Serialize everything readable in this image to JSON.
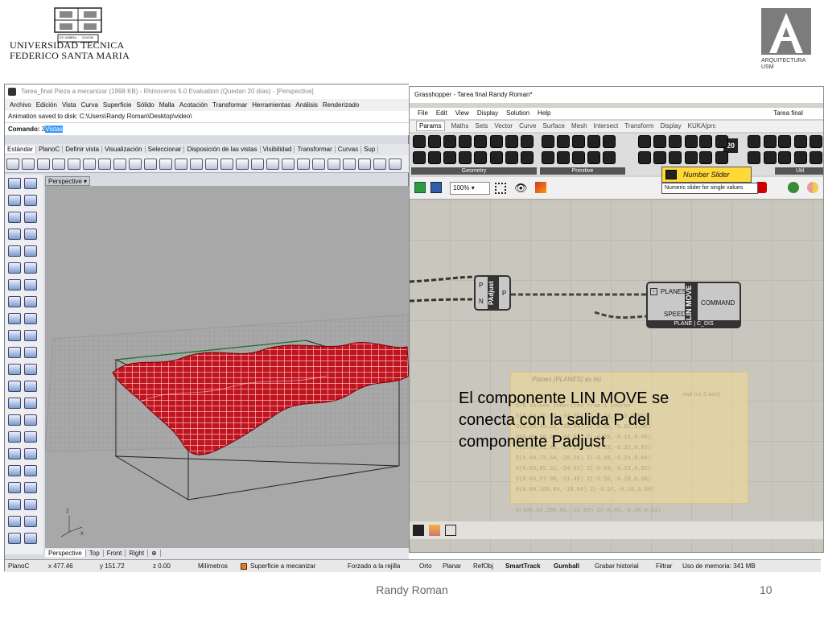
{
  "header": {
    "university_line1": "UNIVERSIDAD TECNICA",
    "university_line2": "FEDERICO SANTA MARIA",
    "crest_motto_left": "EX UMBRA",
    "crest_motto_right": "SOLEM",
    "arch_line1": "ARQUITECTURA",
    "arch_line2": "USM"
  },
  "rhino": {
    "title": "Tarea_final Pieza a mecanizar (1998 KB) - Rhinoceros 5.0 Evaluation (Quedan 20 días) - [Perspective]",
    "menu": [
      "Archivo",
      "Edición",
      "Vista",
      "Curva",
      "Superficie",
      "Sólido",
      "Malla",
      "Acotación",
      "Transformar",
      "Herramientas",
      "Análisis",
      "Renderizado"
    ],
    "command_history": "Animation saved to disk: C:\\Users\\Randy Roman\\Desktop\\video\\",
    "command_label": "Comando:",
    "command_prefix": "3",
    "command_value": "Vistas",
    "toolbar_tabs": [
      "Estándar",
      "PlanoC",
      "Definir vista",
      "Visualización",
      "Seleccionar",
      "Disposición de las vistas",
      "Visibilidad",
      "Transformar",
      "Curvas",
      "Sup"
    ],
    "viewport_label": "Perspective",
    "viewport_tabs": [
      "Perspective",
      "Top",
      "Front",
      "Right"
    ],
    "add_tab_glyph": "⊕",
    "axis_z": "z",
    "axis_x": "x",
    "status": {
      "cplane": "PlanoC",
      "x": "x 477.46",
      "y": "y 151.72",
      "z": "z 0.00",
      "units": "Milímetros",
      "layer": "Superficie a mecanizar",
      "snap": "Forzado a la rejilla",
      "ortho": "Orto",
      "planar": "Planar",
      "osnap": "RefObj",
      "smarttrack": "SmartTrack",
      "gumball": "Gumball",
      "history": "Grabar historial",
      "filter": "Filtrar",
      "memory": "Uso de memoria: 341 MB"
    }
  },
  "grasshopper": {
    "title": "Grasshopper - Tarea final Randy Roman*",
    "file_name": "Tarea final Randy",
    "menu": [
      "File",
      "Edit",
      "View",
      "Display",
      "Solution",
      "Help"
    ],
    "tabs": [
      "Params",
      "Maths",
      "Sets",
      "Vector",
      "Curve",
      "Surface",
      "Mesh",
      "Intersect",
      "Transform",
      "Display",
      "KUKA|prc"
    ],
    "groups": [
      "Geometry",
      "Primitive",
      "Util"
    ],
    "slider_badge": "20",
    "zoom": "100%",
    "tooltip_title": "Number Slider",
    "tooltip_desc": "Numeric slider for single values",
    "padjust": {
      "in_p": "P",
      "in_n": "N",
      "name": "PAdjust",
      "out": "P"
    },
    "linmove": {
      "in1": "PLANES",
      "in2": "SPEED",
      "name": "LIN MOVE",
      "out": "COMMAND",
      "footer": "PLANE | C_DIS"
    },
    "panel": {
      "header": "Planes (PLANES) as list",
      "aside": "mal (i.e Z-axis)",
      "lines": [
        "676 values inherited from 1 source",
        "O(0.00,26.92,-34.35) Z(-0.13,0.13,0.98)",
        "O(0.00,39.23,-28.94) Z(-0.09,-0.03,1.00)",
        "O(0.00,50.31,-34.93) Z(-0.20,-0.16,0.96)",
        "O(0.00,61.45,-27.29) Z(-0.23,-0.22,0.93)",
        "O(0.00,73.54,-26.20) Z(-0.49,-0.24,0.84)",
        "O(0.00,85.32,-24.63) Z(-0.54,-0.23,0.81)",
        "O(0.00,97.08,-21.49) Z(-0.56,-0.20,0.80)",
        "O(0.00,109.84,-18.84) Z(-0.57,-0.16,0.80)",
        "...",
        "O(300.00,300.00,-25.69) Z(-0.40,-0.40,0.83)"
      ]
    }
  },
  "callout": "El componente LIN MOVE se conecta con la salida P del componente Padjust",
  "footer": {
    "author": "Randy Roman",
    "page": "10"
  },
  "colors": {
    "surface": "#c0141e",
    "tooltip": "#ffd93a",
    "canvas": "#c9c6bd"
  }
}
